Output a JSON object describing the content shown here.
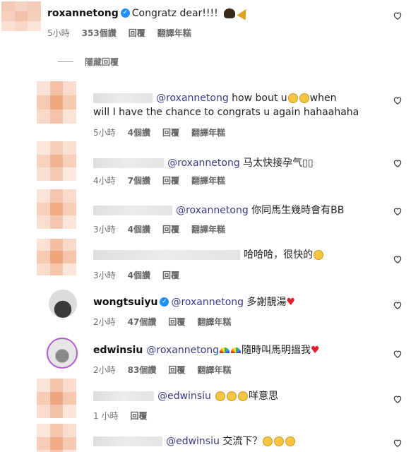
{
  "comment": {
    "username": "roxannetong",
    "text": "Congratz dear!!!!",
    "emoji": [
      "bow-emoji",
      "party-popper-emoji"
    ],
    "time": "5小時",
    "likes": "353個讚",
    "reply": "回覆",
    "translate": "翻譯年糕"
  },
  "hidden_replies_label": "隱藏回覆",
  "replies": [
    {
      "mention": "@roxannetong",
      "text_line1": " how bout u",
      "text_after_emoji": "when",
      "text_line2": "will I have the chance to congrats u again hahaahaha",
      "time": "5小時",
      "likes": "4個讚",
      "reply": "回覆",
      "translate": "翻譯年糕"
    },
    {
      "mention": "@roxannetong",
      "text": " 马太快接孕气▯▯",
      "time": "4小時",
      "likes": "7個讚",
      "reply": "回覆",
      "translate": "翻譯年糕"
    },
    {
      "mention": "@roxannetong",
      "text": " 你同馬生幾時會有BB",
      "time": "3小時",
      "likes": "4個讚",
      "reply": "回覆",
      "translate": "翻譯年糕"
    },
    {
      "text": "哈哈哈，很快的",
      "time": "3小時",
      "likes": "4個讚",
      "reply": "回覆"
    },
    {
      "username": "wongtsuiyu",
      "mention": "@roxannetong",
      "text": " 多謝靚湯",
      "time": "2小時",
      "likes": "47個讚",
      "reply": "回覆",
      "translate": "翻譯年糕"
    },
    {
      "username": "edwinsiu",
      "mention": "@roxannetong",
      "text": "隨時叫馬明搵我",
      "time": "2小時",
      "likes": "83個讚",
      "reply": "回覆",
      "translate": "翻譯年糕"
    },
    {
      "mention": "@edwinsiu",
      "text": "咩意思",
      "time": "1 小時",
      "reply": "回覆"
    },
    {
      "mention": "@edwinsiu",
      "text": " 交流下？"
    }
  ],
  "colors": {
    "verified": "#1e90ff",
    "heart": "#e0202a",
    "meta": "#737373"
  }
}
